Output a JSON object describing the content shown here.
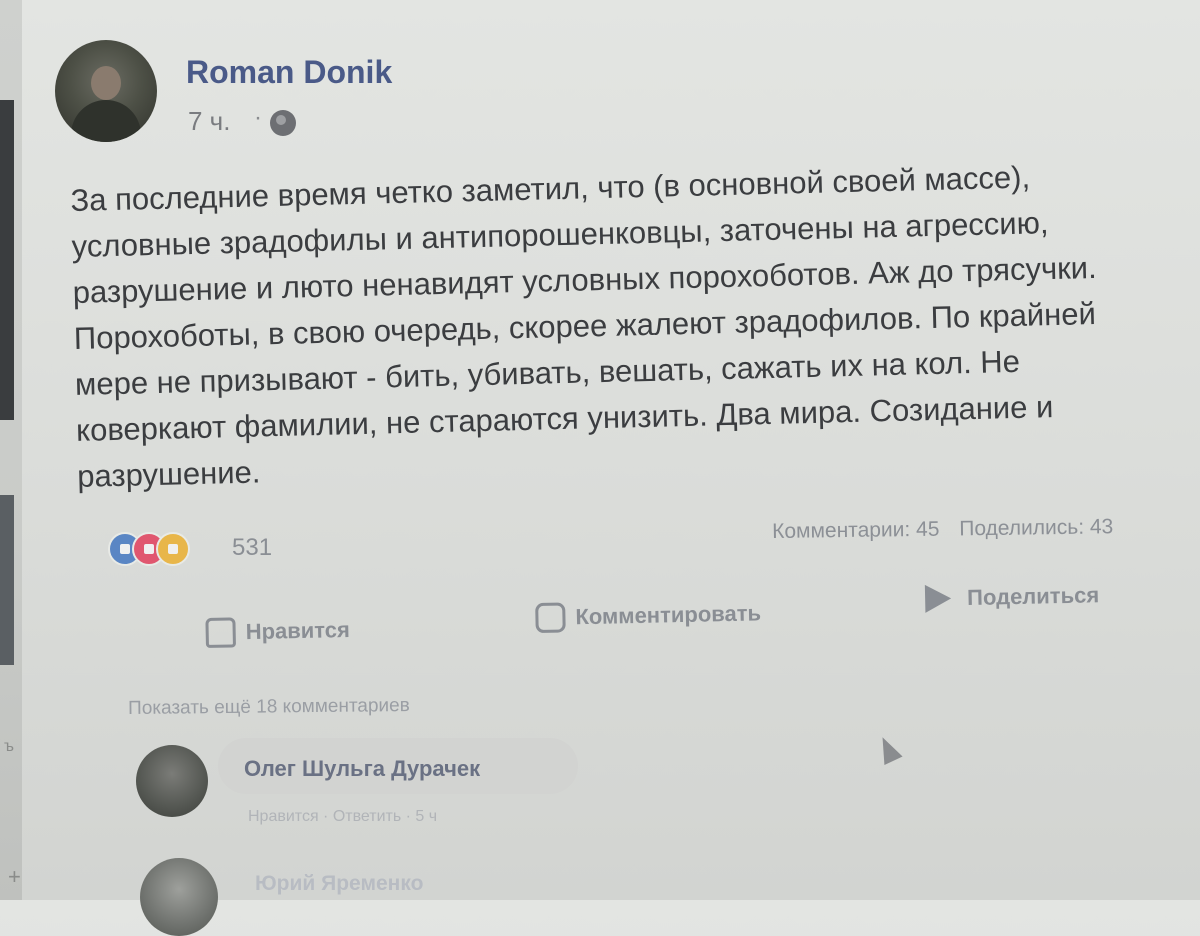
{
  "post": {
    "author": "Roman Donik",
    "time": "7 ч.",
    "separator": "·",
    "text": "За последние время четко заметил, что (в основной своей массе),\nусловные зрадофилы и антипорошенковцы, заточены на агрессию,\nразрушение и люто ненавидят условных порохоботов. Аж до трясучки.\nПорохоботы, в свою очередь, скорее жалеют зрадофилов. По крайней\nмере не призывают - бить, убивать, вешать, сажать их на кол. Не\nковеркают фамилии, не стараются унизить. Два мира. Созидание и\nразрушение."
  },
  "reactions": {
    "count": "531",
    "icons": [
      "like-icon",
      "love-icon",
      "haha-icon"
    ]
  },
  "stats": {
    "comments": "Комментарии: 45",
    "shares": "Поделились: 43"
  },
  "actions": {
    "like_label": "Нравится",
    "comment_label": "Комментировать",
    "share_label": "Поделиться"
  },
  "comments": {
    "more_label": "Показать ещё 18 комментариев",
    "items": [
      {
        "author": "Олег Шульга",
        "text": "Дурачек",
        "meta": "Нравится · Ответить · 5 ч"
      }
    ],
    "next_author": "Юрий Яременко"
  },
  "colors": {
    "author_link": "#4a5a88",
    "text": "#3b3d40",
    "muted": "#8a8e94",
    "like_reaction": "#5a86c4",
    "love_reaction": "#e0576f",
    "haha_reaction": "#e8b64a"
  }
}
